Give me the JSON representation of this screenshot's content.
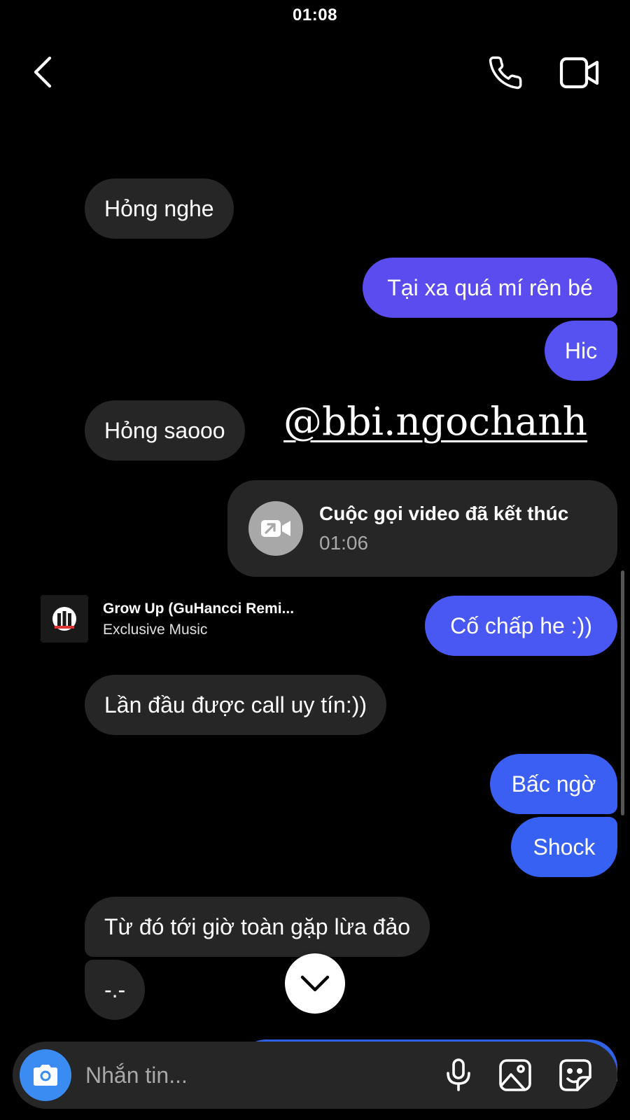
{
  "status_bar": {
    "time": "01:08"
  },
  "header": {
    "back_icon": "chevron-left-icon",
    "call_icon": "phone-icon",
    "video_icon": "video-camera-icon"
  },
  "messages": {
    "m1": "Hỏng nghe",
    "m2": "Tại xa quá mí rên bé",
    "m3": "Hic",
    "m4": "Hỏng saooo",
    "m5": "Cố chấp he :))",
    "m6": "Lần đầu được call uy tín:))",
    "m7": "Bấc ngờ",
    "m8": "Shock",
    "m9": "Từ đó tới giờ toàn gặp lừa đảo",
    "m10": "-.-"
  },
  "watermark": "@bbi.ngochanh",
  "call_card": {
    "title": "Cuộc gọi video đã kết thúc",
    "duration": "01:06",
    "icon": "video-call-arrow-icon"
  },
  "music": {
    "title": "Grow Up (GuHancci Remi...",
    "artist": "Exclusive Music"
  },
  "composer": {
    "placeholder": "Nhắn tin...",
    "icons": [
      "camera-icon",
      "microphone-icon",
      "gallery-icon",
      "sticker-icon"
    ]
  },
  "colors": {
    "background": "#000000",
    "incoming_bubble": "#262626",
    "outgoing_purple": "#5b4cf0",
    "outgoing_blue": "#3661f2",
    "camera_button": "#3a8cf2"
  }
}
